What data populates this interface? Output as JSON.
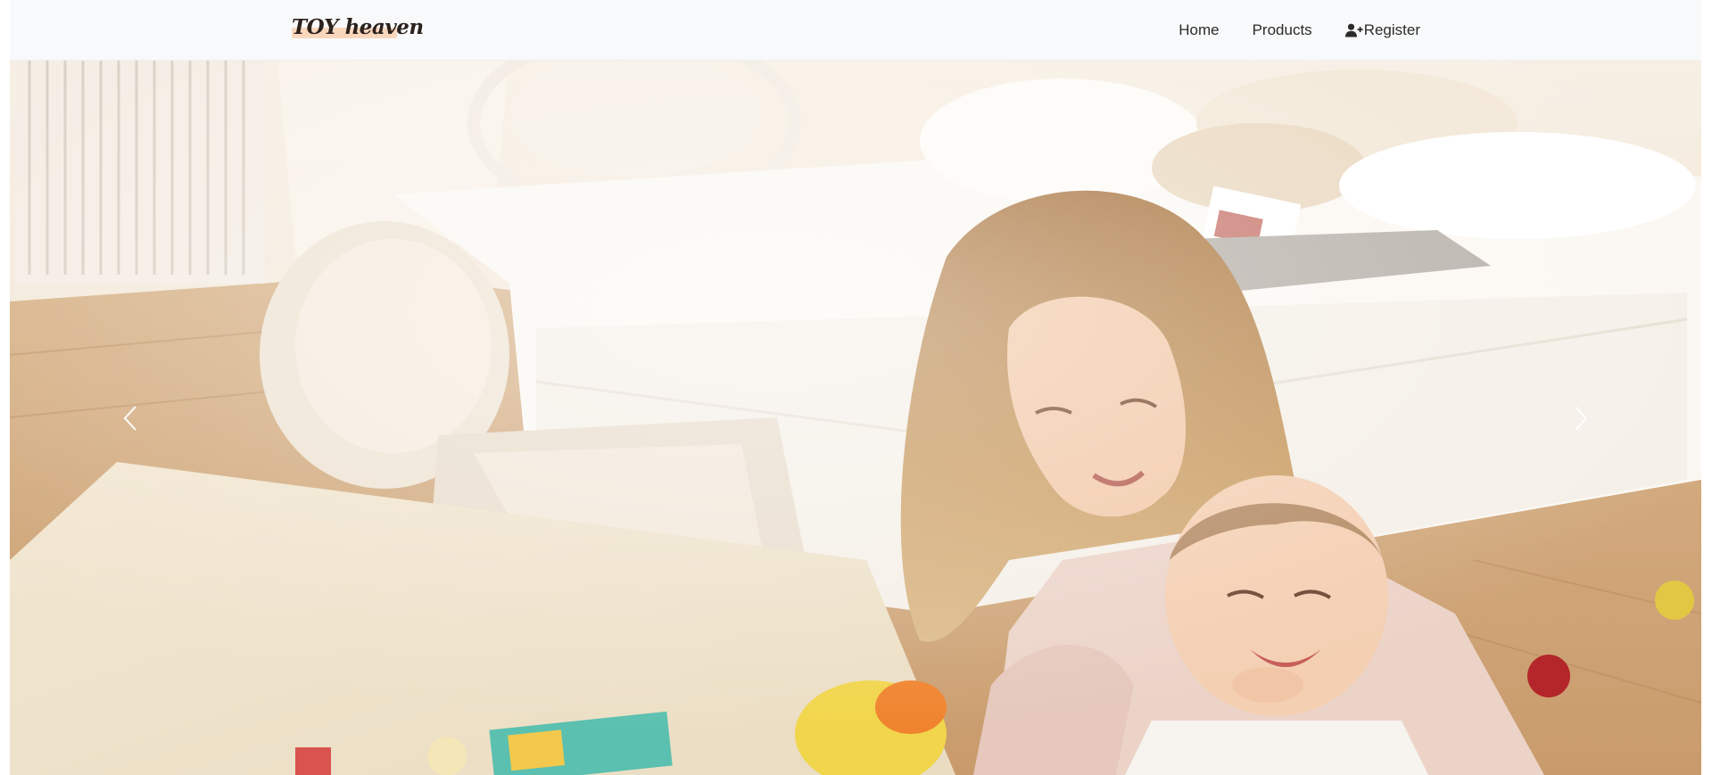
{
  "brand": {
    "name": "TOY heaven"
  },
  "nav": {
    "items": [
      {
        "label": "Home",
        "icon": ""
      },
      {
        "label": "Products",
        "icon": ""
      },
      {
        "label": "Register",
        "icon": "user-plus-icon"
      }
    ]
  },
  "carousel": {
    "prev_icon": "chevron-left-icon",
    "next_icon": "chevron-right-icon"
  },
  "colors": {
    "navbar_bg": "#f8f9fa",
    "brand_text": "#2b211d",
    "brand_highlight": "#f9d7bd",
    "nav_text": "#2b2b2b"
  }
}
